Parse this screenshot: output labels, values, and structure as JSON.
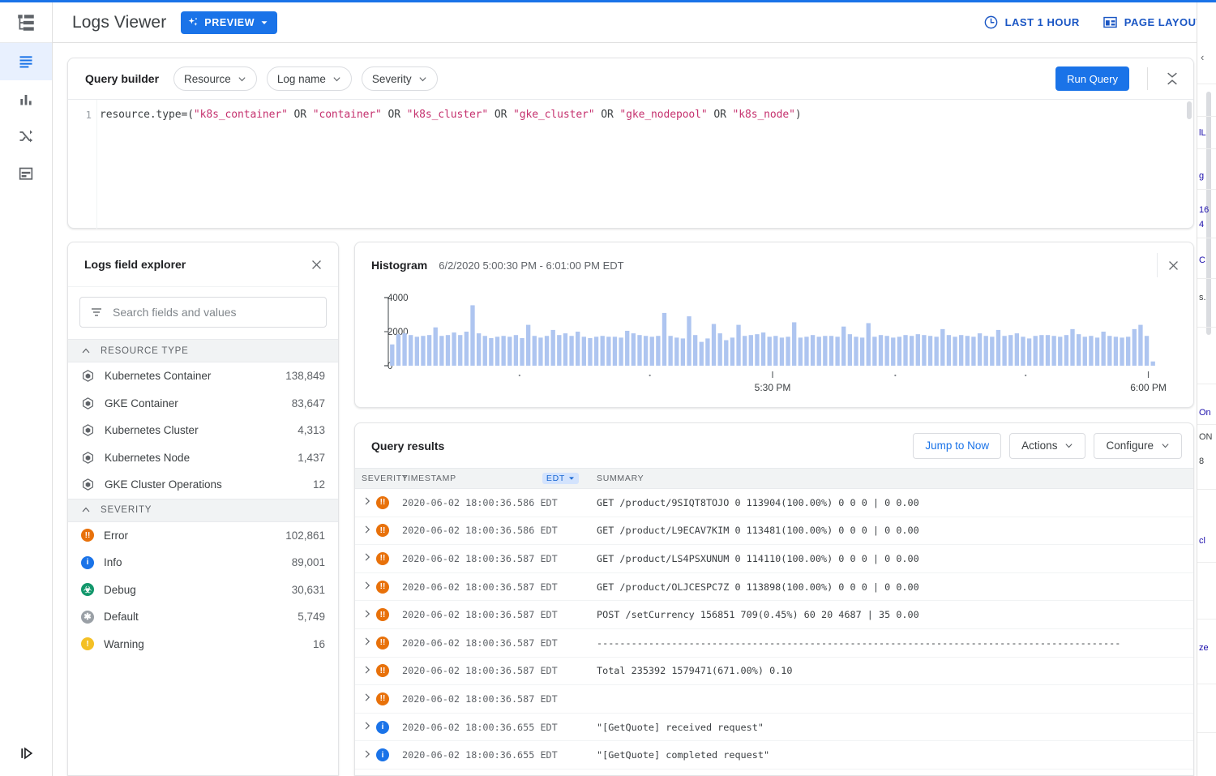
{
  "app": {
    "title": "Logs Viewer",
    "preview_badge": "PREVIEW",
    "accent": "#1a73e8"
  },
  "header": {
    "time_range": "LAST 1 HOUR",
    "page_layout": "PAGE LAYOUT"
  },
  "rail": {
    "items": [
      {
        "icon": "logs-icon",
        "active": true
      },
      {
        "icon": "bar-chart-icon",
        "active": false
      },
      {
        "icon": "shuffle-icon",
        "active": false
      },
      {
        "icon": "calendar-icon",
        "active": false
      }
    ],
    "expand": "expand-panel-icon"
  },
  "query_builder": {
    "title": "Query builder",
    "chips": [
      {
        "label": "Resource"
      },
      {
        "label": "Log name"
      },
      {
        "label": "Severity"
      }
    ],
    "run_label": "Run Query",
    "line_number": "1",
    "query_tokens": [
      {
        "t": "resource.type=",
        "c": "plain"
      },
      {
        "t": "(",
        "c": "paren"
      },
      {
        "t": "\"k8s_container\"",
        "c": "str"
      },
      {
        "t": " OR ",
        "c": "plain"
      },
      {
        "t": "\"container\"",
        "c": "str"
      },
      {
        "t": " OR ",
        "c": "plain"
      },
      {
        "t": "\"k8s_cluster\"",
        "c": "str"
      },
      {
        "t": " OR ",
        "c": "plain"
      },
      {
        "t": "\"gke_cluster\"",
        "c": "str"
      },
      {
        "t": " OR ",
        "c": "plain"
      },
      {
        "t": "\"gke_nodepool\"",
        "c": "str"
      },
      {
        "t": " OR ",
        "c": "plain"
      },
      {
        "t": "\"k8s_node\"",
        "c": "str"
      },
      {
        "t": ")",
        "c": "paren"
      }
    ]
  },
  "field_explorer": {
    "title": "Logs field explorer",
    "search_placeholder": "Search fields and values",
    "search_value": "",
    "sections": [
      {
        "name": "RESOURCE TYPE",
        "rows": [
          {
            "label": "Kubernetes Container",
            "count": "138,849",
            "icon": "resource-icon"
          },
          {
            "label": "GKE Container",
            "count": "83,647",
            "icon": "resource-icon"
          },
          {
            "label": "Kubernetes Cluster",
            "count": "4,313",
            "icon": "resource-icon"
          },
          {
            "label": "Kubernetes Node",
            "count": "1,437",
            "icon": "resource-icon"
          },
          {
            "label": "GKE Cluster Operations",
            "count": "12",
            "icon": "resource-icon"
          }
        ]
      },
      {
        "name": "SEVERITY",
        "rows": [
          {
            "label": "Error",
            "count": "102,861",
            "icon": "severity-error-icon",
            "color": "#e8710a",
            "glyph": "!!"
          },
          {
            "label": "Info",
            "count": "89,001",
            "icon": "severity-info-icon",
            "color": "#1a73e8",
            "glyph": "i"
          },
          {
            "label": "Debug",
            "count": "30,631",
            "icon": "severity-debug-icon",
            "color": "#12976b",
            "glyph": "☸"
          },
          {
            "label": "Default",
            "count": "5,749",
            "icon": "severity-default-icon",
            "color": "#9aa0a6",
            "glyph": "✱"
          },
          {
            "label": "Warning",
            "count": "16",
            "icon": "severity-warning-icon",
            "color": "#f4c025",
            "glyph": "!"
          }
        ]
      }
    ]
  },
  "histogram": {
    "title": "Histogram",
    "range": "6/2/2020 5:00:30 PM - 6:01:00 PM EDT"
  },
  "chart_data": {
    "type": "bar",
    "title": "Histogram",
    "subtitle": "6/2/2020 5:00:30 PM - 6:01:00 PM EDT",
    "xlabel": "",
    "ylabel": "",
    "ylim": [
      0,
      4000
    ],
    "yticks": [
      0,
      2000,
      4000
    ],
    "ytick_labels": [
      "0",
      "2000",
      "4000"
    ],
    "xticks": [
      "5:30 PM",
      "6:00 PM"
    ],
    "grid": false,
    "legend": null,
    "bar_color": "#aec5f0",
    "values": [
      1250,
      1850,
      1900,
      1800,
      1700,
      1750,
      1800,
      2250,
      1750,
      1800,
      1950,
      1800,
      2000,
      3550,
      1900,
      1750,
      1620,
      1700,
      1750,
      1700,
      1800,
      1620,
      2400,
      1750,
      1650,
      1750,
      2100,
      1800,
      1900,
      1750,
      2000,
      1700,
      1620,
      1700,
      1750,
      1700,
      1700,
      1650,
      2050,
      1900,
      1800,
      1750,
      1700,
      1750,
      3100,
      1750,
      1650,
      1600,
      2900,
      1800,
      1400,
      1600,
      2450,
      1900,
      1500,
      1650,
      2400,
      1750,
      1800,
      1850,
      1950,
      1700,
      1750,
      1650,
      1700,
      2550,
      1650,
      1700,
      1800,
      1700,
      1750,
      1750,
      1700,
      2300,
      1850,
      1700,
      1650,
      2500,
      1700,
      1800,
      1750,
      1650,
      1700,
      1800,
      1750,
      1850,
      1800,
      1750,
      1700,
      2150,
      1800,
      1700,
      1800,
      1750,
      1700,
      1900,
      1750,
      1700,
      2100,
      1750,
      1800,
      1900,
      1700,
      1600,
      1750,
      1800,
      1800,
      1750,
      1700,
      1800,
      2150,
      1850,
      1700,
      1750,
      1650,
      2000,
      1750,
      1700,
      1650,
      1700,
      2150,
      2400,
      1750,
      250
    ]
  },
  "query_results": {
    "title": "Query results",
    "jump_to_now": "Jump to Now",
    "actions": "Actions",
    "configure": "Configure",
    "columns": {
      "severity": "SEVERITY",
      "timestamp": "TIMESTAMP",
      "timezone": "EDT",
      "summary": "SUMMARY"
    },
    "rows": [
      {
        "severity": "error",
        "timestamp": "2020-06-02 18:00:36.586 EDT",
        "summary": "GET /product/9SIQT8TOJO 0 113904(100.00%) 0 0 0 | 0 0.00"
      },
      {
        "severity": "error",
        "timestamp": "2020-06-02 18:00:36.586 EDT",
        "summary": "GET /product/L9ECAV7KIM 0 113481(100.00%) 0 0 0 | 0 0.00"
      },
      {
        "severity": "error",
        "timestamp": "2020-06-02 18:00:36.587 EDT",
        "summary": "GET /product/LS4PSXUNUM 0 114110(100.00%) 0 0 0 | 0 0.00"
      },
      {
        "severity": "error",
        "timestamp": "2020-06-02 18:00:36.587 EDT",
        "summary": "GET /product/OLJCESPC7Z 0 113898(100.00%) 0 0 0 | 0 0.00"
      },
      {
        "severity": "error",
        "timestamp": "2020-06-02 18:00:36.587 EDT",
        "summary": "POST /setCurrency 156851 709(0.45%) 60 20 4687 | 35 0.00"
      },
      {
        "severity": "error",
        "timestamp": "2020-06-02 18:00:36.587 EDT",
        "summary": "-------------------------------------------------------------------------------------------"
      },
      {
        "severity": "error",
        "timestamp": "2020-06-02 18:00:36.587 EDT",
        "summary": "Total 235392 1579471(671.00%) 0.10"
      },
      {
        "severity": "error",
        "timestamp": "2020-06-02 18:00:36.587 EDT",
        "summary": ""
      },
      {
        "severity": "info",
        "timestamp": "2020-06-02 18:00:36.655 EDT",
        "summary": "\"[GetQuote] received request\""
      },
      {
        "severity": "info",
        "timestamp": "2020-06-02 18:00:36.655 EDT",
        "summary": "\"[GetQuote] completed request\""
      }
    ],
    "severity_colors": {
      "error": "#e8710a",
      "info": "#1a73e8"
    }
  },
  "edge_panel": {
    "lines": [
      {
        "text": "lL",
        "top": 155,
        "dark": false
      },
      {
        "text": "g",
        "top": 208,
        "dark": false
      },
      {
        "text": "16",
        "top": 250,
        "dark": false
      },
      {
        "text": "4",
        "top": 268,
        "dark": false
      },
      {
        "text": "C",
        "top": 312,
        "dark": false
      },
      {
        "text": "s.",
        "top": 358,
        "dark": true
      },
      {
        "text": "On",
        "top": 500,
        "dark": false
      },
      {
        "text": "ON",
        "top": 530,
        "dark": true
      },
      {
        "text": "8",
        "top": 560,
        "dark": true
      },
      {
        "text": "cl",
        "top": 658,
        "dark": false
      },
      {
        "text": "ze",
        "top": 790,
        "dark": false
      }
    ]
  }
}
